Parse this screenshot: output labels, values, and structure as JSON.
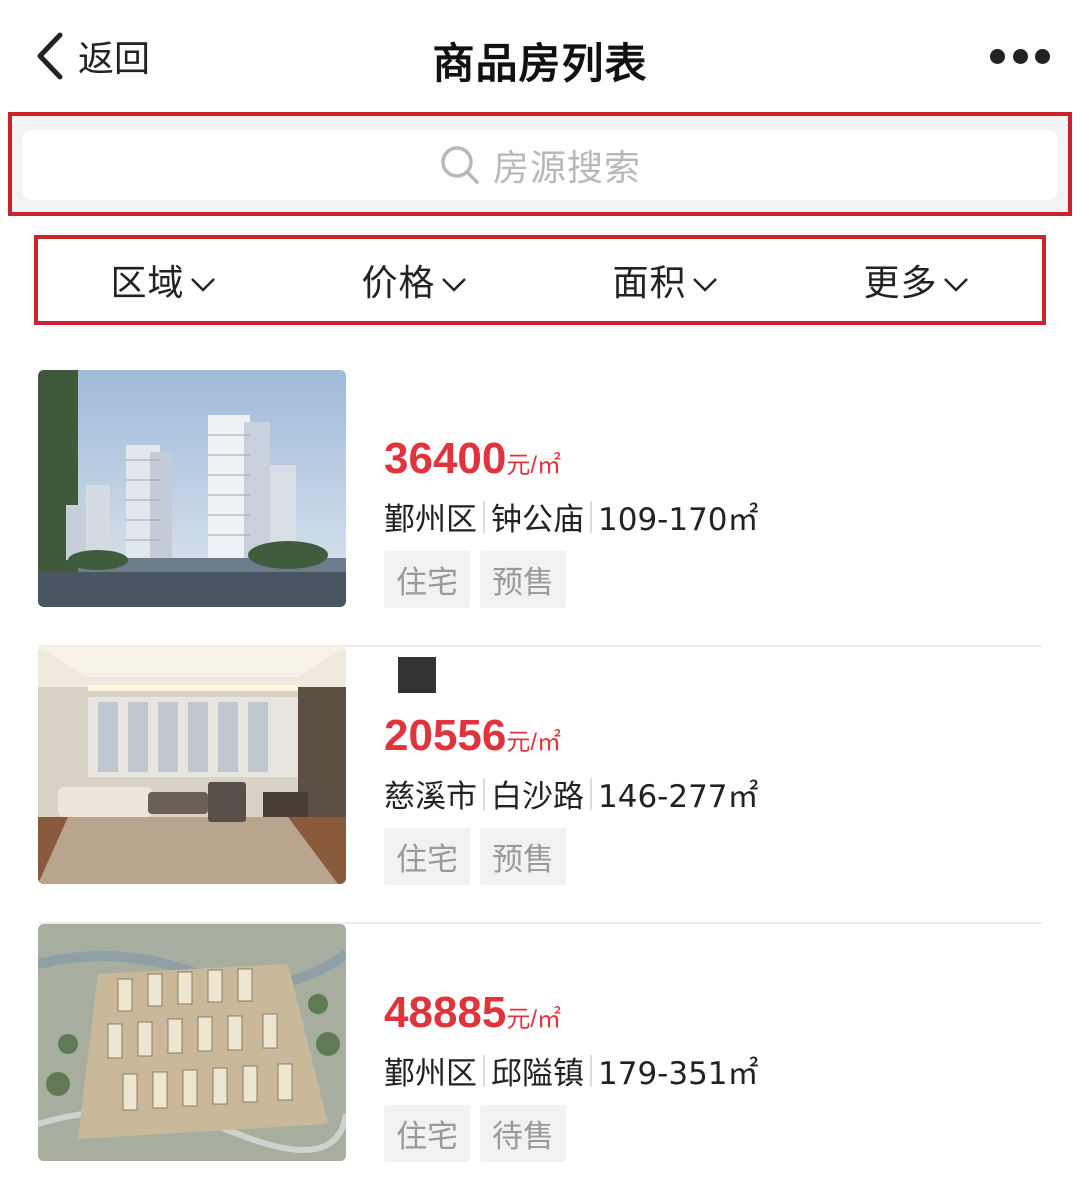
{
  "nav": {
    "back_label": "返回",
    "title": "商品房列表"
  },
  "search": {
    "placeholder": "房源搜索"
  },
  "filters": [
    "区域",
    "价格",
    "面积",
    "更多"
  ],
  "listings": [
    {
      "price": "36400",
      "unit": "元/㎡",
      "district": "鄞州区",
      "area_name": "钟公庙",
      "size": "109-170㎡",
      "tags": [
        "住宅",
        "预售"
      ]
    },
    {
      "price": "20556",
      "unit": "元/㎡",
      "district": "慈溪市",
      "area_name": "白沙路",
      "size": "146-277㎡",
      "tags": [
        "住宅",
        "预售"
      ]
    },
    {
      "price": "48885",
      "unit": "元/㎡",
      "district": "鄞州区",
      "area_name": "邱隘镇",
      "size": "179-351㎡",
      "tags": [
        "住宅",
        "待售"
      ]
    }
  ]
}
